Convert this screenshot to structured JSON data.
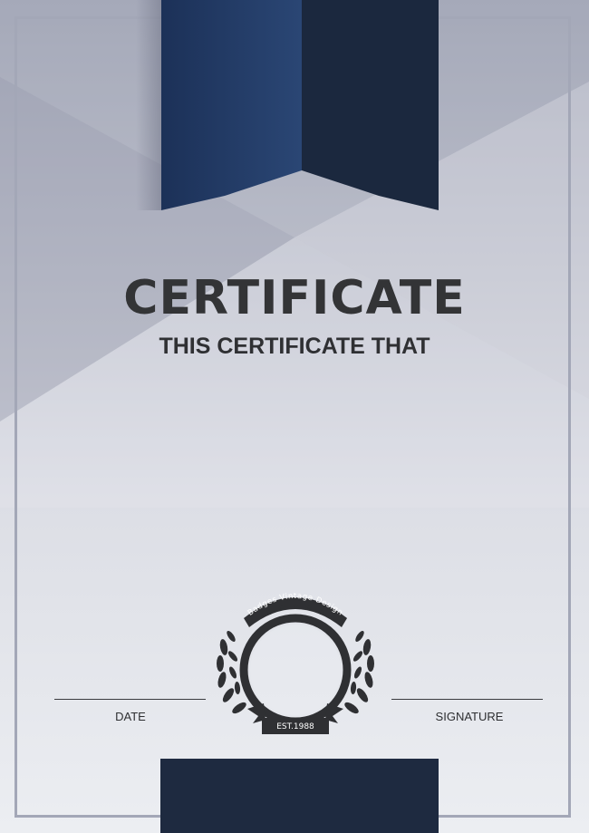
{
  "certificate": {
    "title": "CERTIFICATE",
    "subtitle": "THIS CERTIFICATE THAT",
    "date_label": "DATE",
    "signature_label": "SIGNATURE"
  },
  "badge": {
    "top_text": "Badges Vintage Design",
    "bottom_text": "EST.1988",
    "star_count": 5
  },
  "colors": {
    "ribbon_dark": "#1d2a3f",
    "ribbon_blue": "#233a63",
    "text_dark": "#333436",
    "frame": "#a3a7b7"
  }
}
